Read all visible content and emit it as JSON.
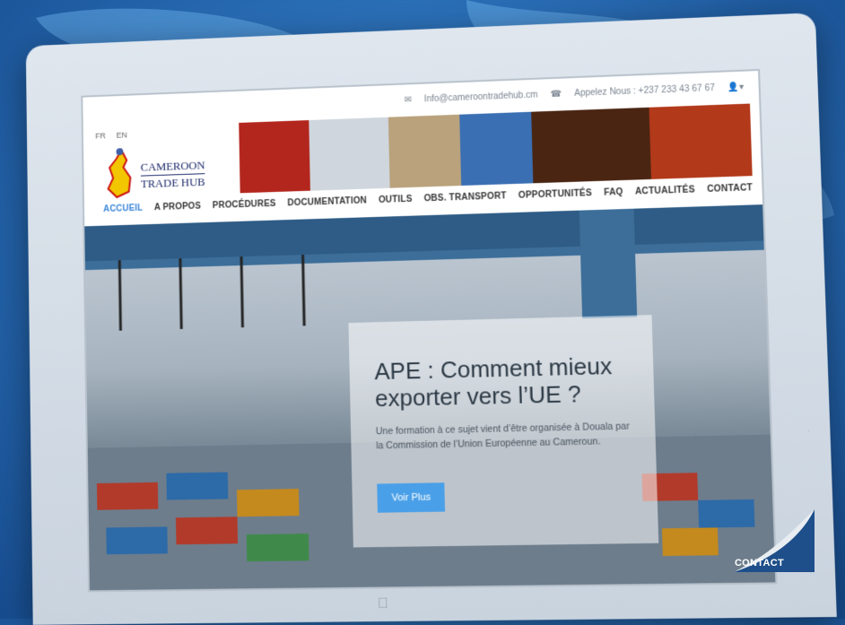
{
  "topbar": {
    "email": "Info@cameroontradehub.cm",
    "phone": "Appelez Nous : +237 233 43 67 67"
  },
  "lang": [
    "FR",
    "EN"
  ],
  "logo": {
    "line1": "CAMEROON",
    "line2": "TRADE HUB"
  },
  "nav": [
    "ACCUEIL",
    "A PROPOS",
    "PROCÉDURES",
    "DOCUMENTATION",
    "OUTILS",
    "OBS. TRANSPORT",
    "OPPORTUNITÉS",
    "FAQ",
    "ACTUALITÉS",
    "CONTACT"
  ],
  "hero": {
    "title": "APE : Comment mieux exporter vers l’UE ?",
    "text": "Une formation à ce sujet vient d’être organisée à Douala par la Commission de l’Union Européenne au Cameroun.",
    "button": "Voir Plus"
  },
  "corner_tag": "CONTACT",
  "colors": {
    "accent": "#4aa0e8",
    "nav_active": "#3a87d9"
  }
}
